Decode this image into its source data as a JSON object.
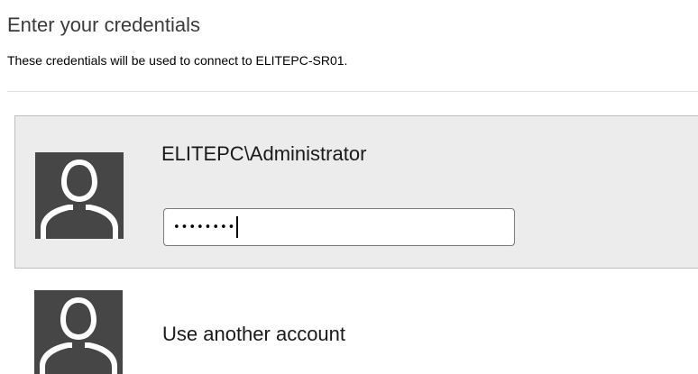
{
  "dialog": {
    "title": "Enter your credentials",
    "subtitle": "These credentials will be used to connect to ELITEPC-SR01."
  },
  "accounts": [
    {
      "name": "ELITEPC\\Administrator",
      "selected": true,
      "avatar_icon": "user-silhouette-icon",
      "password": {
        "masked_value": "••••••••",
        "placeholder": ""
      }
    },
    {
      "name": "Use another account",
      "selected": false,
      "avatar_icon": "user-silhouette-icon"
    }
  ],
  "colors": {
    "avatar_background": "#464646",
    "avatar_figure": "#ffffff",
    "selected_tile_background": "#ececec",
    "selected_tile_border": "#bdbdbd",
    "divider": "#e0e0e0"
  }
}
